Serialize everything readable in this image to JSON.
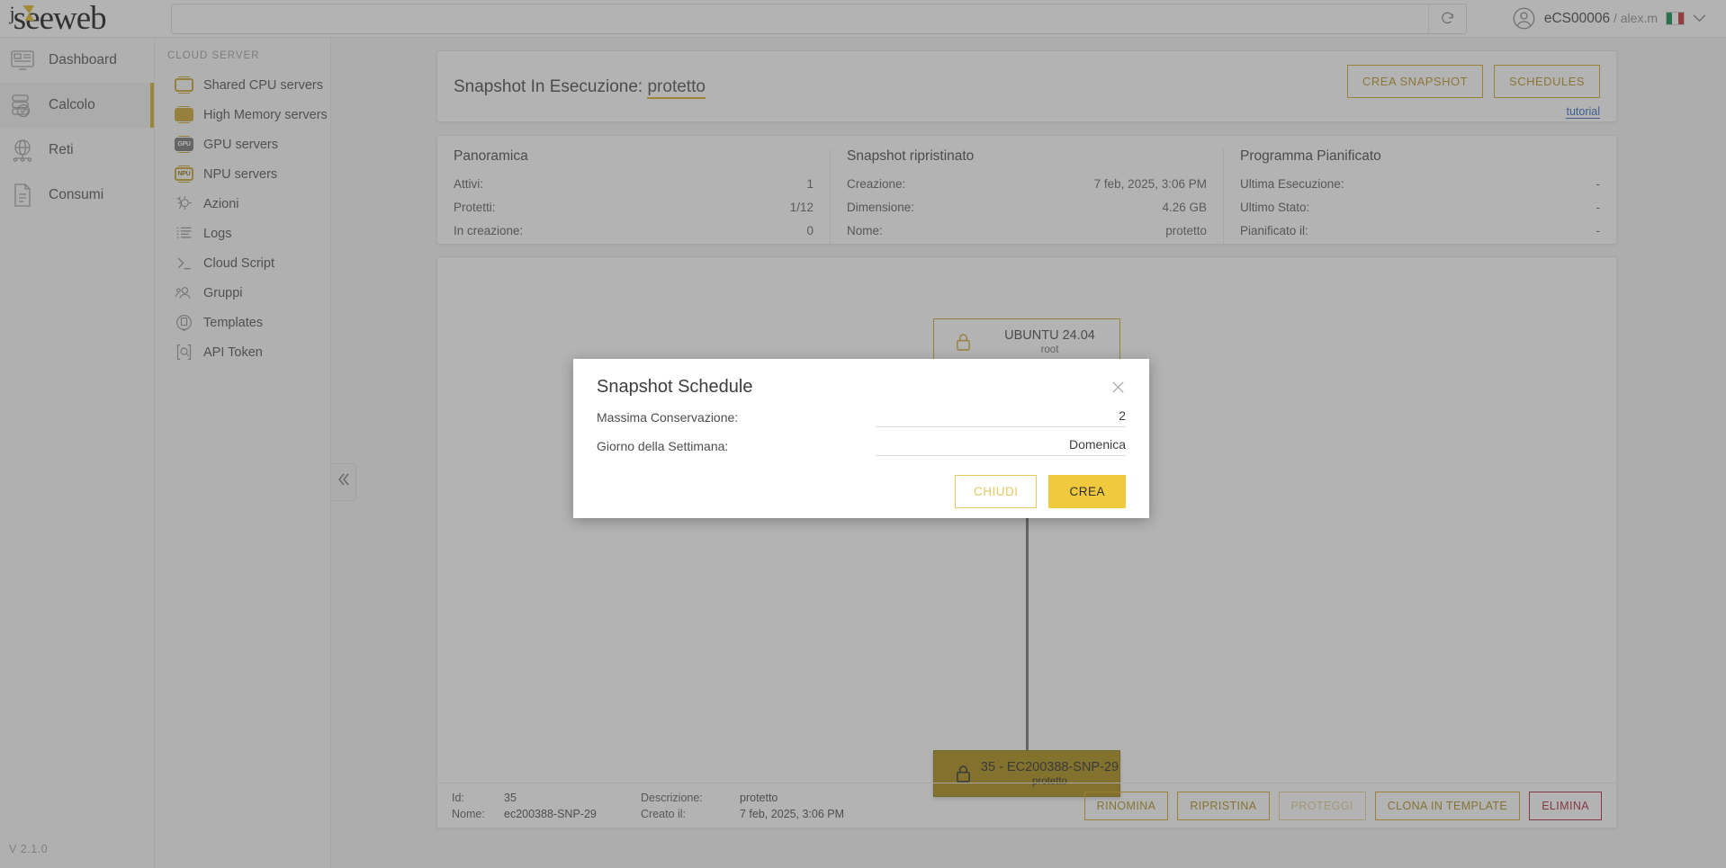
{
  "topbar": {
    "logo_text": "seeweb",
    "search_value": "",
    "search_placeholder": "",
    "reload_icon": "reload-icon",
    "user_account": "eCS00006",
    "user_separator": " / ",
    "user_name": "alex.m",
    "flag": "italy-flag",
    "caret": "⌄"
  },
  "leftnav": {
    "items": [
      {
        "label": "Dashboard",
        "icon": "dashboard-icon",
        "active": false
      },
      {
        "label": "Calcolo",
        "icon": "servers-icon",
        "active": true
      },
      {
        "label": "Reti",
        "icon": "network-icon",
        "active": false
      },
      {
        "label": "Consumi",
        "icon": "document-icon",
        "active": false
      }
    ],
    "version": "V 2.1.0"
  },
  "subnav": {
    "title": "CLOUD SERVER",
    "items": [
      {
        "label": "Shared CPU servers",
        "icon": "cpu-chip-icon"
      },
      {
        "label": "High Memory servers",
        "icon": "memory-chip-icon"
      },
      {
        "label": "GPU servers",
        "icon": "gpu-chip-icon"
      },
      {
        "label": "NPU servers",
        "icon": "npu-chip-icon"
      },
      {
        "label": "Azioni",
        "icon": "actions-gear-icon"
      },
      {
        "label": "Logs",
        "icon": "logs-list-icon"
      },
      {
        "label": "Cloud Script",
        "icon": "terminal-icon"
      },
      {
        "label": "Gruppi",
        "icon": "group-users-icon"
      },
      {
        "label": "Templates",
        "icon": "template-icon"
      },
      {
        "label": "API Token",
        "icon": "api-token-icon"
      }
    ]
  },
  "collapse": {
    "icon": "chevron-double-left-icon"
  },
  "header": {
    "title_prefix": "Snapshot In Esecuzione: ",
    "title_highlight": "protetto",
    "crea_snapshot": "CREA SNAPSHOT",
    "schedules": "SCHEDULES",
    "tutorial": "tutorial"
  },
  "info": {
    "panoramica": {
      "heading": "Panoramica",
      "rows": [
        {
          "key": "Attivi:",
          "value": "1"
        },
        {
          "key": "Protetti:",
          "value": "1/12"
        },
        {
          "key": "In creazione:",
          "value": "0"
        }
      ]
    },
    "ripristinato": {
      "heading": "Snapshot ripristinato",
      "rows": [
        {
          "key": "Creazione:",
          "value": "7 feb, 2025, 3:06 PM"
        },
        {
          "key": "Dimensione:",
          "value": "4.26 GB"
        },
        {
          "key": "Nome:",
          "value": "protetto"
        }
      ]
    },
    "programma": {
      "heading": "Programma Pianificato",
      "rows": [
        {
          "key": "Ultima Esecuzione:",
          "value": "-"
        },
        {
          "key": "Ultimo Stato:",
          "value": "-"
        },
        {
          "key": "Pianificato il:",
          "value": "-"
        }
      ]
    }
  },
  "tree": {
    "root_node": {
      "title": "UBUNTU 24.04",
      "subtitle": "root",
      "icon": "lock-icon"
    },
    "snapshot_node": {
      "title": "35 - EC200388-SNP-29",
      "subtitle": "protetto",
      "icon": "lock-icon"
    }
  },
  "detail": {
    "id_key": "Id:",
    "id_value": "35",
    "nome_key": "Nome:",
    "nome_value": "ec200388-SNP-29",
    "desc_key": "Descrizione:",
    "desc_value": "protetto",
    "creato_key": "Creato il:",
    "creato_value": "7 feb, 2025, 3:06 PM",
    "actions": [
      {
        "label": "RINOMINA",
        "state": "enabled"
      },
      {
        "label": "RIPRISTINA",
        "state": "enabled"
      },
      {
        "label": "PROTEGGI",
        "state": "disabled"
      },
      {
        "label": "CLONA IN TEMPLATE",
        "state": "enabled"
      },
      {
        "label": "ELIMINA",
        "state": "danger"
      }
    ]
  },
  "modal": {
    "title": "Snapshot Schedule",
    "close_icon": "close-icon",
    "fields": [
      {
        "label": "Massima Conservazione:",
        "value": "2"
      },
      {
        "label": "Giorno della Settimana:",
        "value": "Domenica"
      }
    ],
    "cancel_label": "CHIUDI",
    "confirm_label": "CREA"
  },
  "colors": {
    "brand_yellow": "#d9ae16",
    "snapshot_node": "#a7860a",
    "confirm_button": "#f0c93c",
    "danger": "#a41f35",
    "link_blue": "#2d63c8"
  }
}
